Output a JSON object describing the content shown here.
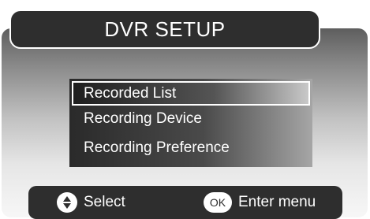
{
  "title": "DVR SETUP",
  "menu": {
    "items": [
      {
        "label": "Recorded List",
        "selected": true
      },
      {
        "label": "Recording Device",
        "selected": false
      },
      {
        "label": "Recording Preference",
        "selected": false
      }
    ]
  },
  "footer": {
    "select_icon": "up-down-arrows-icon",
    "select_label": "Select",
    "ok_icon_text": "OK",
    "enter_label": "Enter menu"
  },
  "colors": {
    "title_bar": "#2e2e2e",
    "footer_bar": "#2e2e2e",
    "text": "#ffffff"
  }
}
